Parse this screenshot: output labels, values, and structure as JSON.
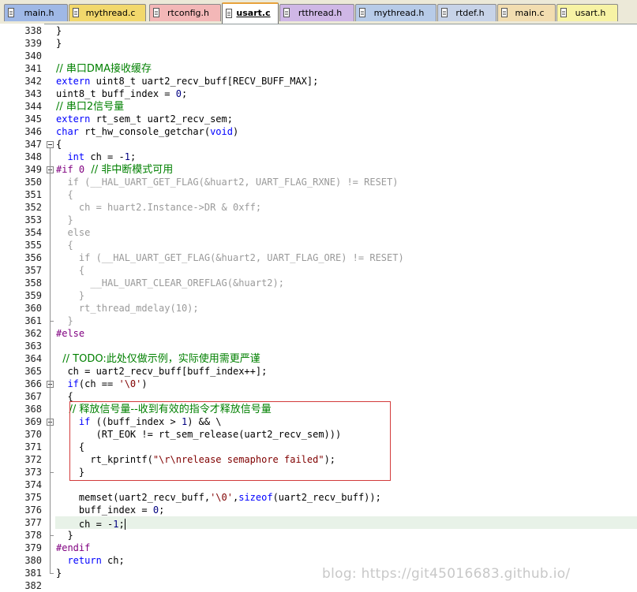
{
  "tabs": [
    {
      "label": "main.h",
      "color": "#9fb8e6",
      "active": false
    },
    {
      "label": "mythread.c",
      "color": "#f2d86c",
      "active": false
    },
    {
      "label": "rtconfig.h",
      "color": "#f3b7b7",
      "active": false
    },
    {
      "label": "usart.c",
      "color": "#ffffff",
      "active": true
    },
    {
      "label": "rtthread.h",
      "color": "#cfb7e6",
      "active": false
    },
    {
      "label": "mythread.h",
      "color": "#b7cbe8",
      "active": false
    },
    {
      "label": "rtdef.h",
      "color": "#c7d3e8",
      "active": false
    },
    {
      "label": "main.c",
      "color": "#f2ddb0",
      "active": false
    },
    {
      "label": "usart.h",
      "color": "#f7f3a4",
      "active": false
    }
  ],
  "lines": [
    {
      "n": "338",
      "segs": [
        {
          "t": "}",
          "c": "pl"
        }
      ]
    },
    {
      "n": "339",
      "segs": [
        {
          "t": "}",
          "c": "pl"
        }
      ]
    },
    {
      "n": "340",
      "segs": []
    },
    {
      "n": "341",
      "segs": [
        {
          "t": "// 串口DMA接收缓存",
          "c": "cm"
        }
      ]
    },
    {
      "n": "342",
      "segs": [
        {
          "t": "extern",
          "c": "kw"
        },
        {
          "t": " uint8_t uart2_recv_buff[RECV_BUFF_MAX];",
          "c": "pl"
        }
      ]
    },
    {
      "n": "343",
      "segs": [
        {
          "t": "uint8_t buff_index = ",
          "c": "pl"
        },
        {
          "t": "0",
          "c": "nm"
        },
        {
          "t": ";",
          "c": "pl"
        }
      ]
    },
    {
      "n": "344",
      "segs": [
        {
          "t": "// 串口2信号量",
          "c": "cm"
        }
      ]
    },
    {
      "n": "345",
      "segs": [
        {
          "t": "extern",
          "c": "kw"
        },
        {
          "t": " rt_sem_t uart2_recv_sem;",
          "c": "pl"
        }
      ]
    },
    {
      "n": "346",
      "segs": [
        {
          "t": "char",
          "c": "kw"
        },
        {
          "t": " rt_hw_console_getchar(",
          "c": "pl"
        },
        {
          "t": "void",
          "c": "kw"
        },
        {
          "t": ")",
          "c": "pl"
        }
      ]
    },
    {
      "n": "347",
      "segs": [
        {
          "t": "{",
          "c": "pl"
        }
      ]
    },
    {
      "n": "348",
      "segs": [
        {
          "t": "  ",
          "c": "pl"
        },
        {
          "t": "int",
          "c": "kw"
        },
        {
          "t": " ch = -",
          "c": "pl"
        },
        {
          "t": "1",
          "c": "nm"
        },
        {
          "t": ";",
          "c": "pl"
        }
      ]
    },
    {
      "n": "349",
      "segs": [
        {
          "t": "#if 0",
          "c": "pp"
        },
        {
          "t": "  // 非中断模式可用",
          "c": "cm"
        }
      ]
    },
    {
      "n": "350",
      "segs": [
        {
          "t": "  if (__HAL_UART_GET_FLAG(&huart2, UART_FLAG_RXNE) != RESET)",
          "c": "gr"
        }
      ]
    },
    {
      "n": "351",
      "segs": [
        {
          "t": "  {",
          "c": "gr"
        }
      ]
    },
    {
      "n": "352",
      "segs": [
        {
          "t": "    ch = huart2.Instance->DR & 0xff;",
          "c": "gr"
        }
      ]
    },
    {
      "n": "353",
      "segs": [
        {
          "t": "  }",
          "c": "gr"
        }
      ]
    },
    {
      "n": "354",
      "segs": [
        {
          "t": "  else",
          "c": "gr"
        }
      ]
    },
    {
      "n": "355",
      "segs": [
        {
          "t": "  {",
          "c": "gr"
        }
      ]
    },
    {
      "n": "356",
      "segs": [
        {
          "t": "    if (__HAL_UART_GET_FLAG(&huart2, UART_FLAG_ORE) != RESET)",
          "c": "gr"
        }
      ]
    },
    {
      "n": "357",
      "segs": [
        {
          "t": "    {",
          "c": "gr"
        }
      ]
    },
    {
      "n": "358",
      "segs": [
        {
          "t": "      __HAL_UART_CLEAR_OREFLAG(&huart2);",
          "c": "gr"
        }
      ]
    },
    {
      "n": "359",
      "segs": [
        {
          "t": "    }",
          "c": "gr"
        }
      ]
    },
    {
      "n": "360",
      "segs": [
        {
          "t": "    rt_thread_mdelay(10);",
          "c": "gr"
        }
      ]
    },
    {
      "n": "361",
      "segs": [
        {
          "t": "  }",
          "c": "gr"
        }
      ]
    },
    {
      "n": "362",
      "segs": [
        {
          "t": "#else",
          "c": "pp"
        }
      ]
    },
    {
      "n": "363",
      "segs": []
    },
    {
      "n": "364",
      "segs": [
        {
          "t": "  // TODO:此处仅做示例，实际使用需更严谨",
          "c": "cm"
        }
      ]
    },
    {
      "n": "365",
      "segs": [
        {
          "t": "  ch = uart2_recv_buff[buff_index++];",
          "c": "pl"
        }
      ]
    },
    {
      "n": "366",
      "segs": [
        {
          "t": "  ",
          "c": "pl"
        },
        {
          "t": "if",
          "c": "kw"
        },
        {
          "t": "(ch == ",
          "c": "pl"
        },
        {
          "t": "'\\0'",
          "c": "st"
        },
        {
          "t": ")",
          "c": "pl"
        }
      ]
    },
    {
      "n": "367",
      "segs": [
        {
          "t": "  {",
          "c": "pl"
        }
      ]
    },
    {
      "n": "368",
      "segs": [
        {
          "t": "    // 释放信号量--收到有效的指令才释放信号量",
          "c": "cm"
        }
      ]
    },
    {
      "n": "369",
      "segs": [
        {
          "t": "    ",
          "c": "pl"
        },
        {
          "t": "if",
          "c": "kw"
        },
        {
          "t": " ((buff_index > ",
          "c": "pl"
        },
        {
          "t": "1",
          "c": "nm"
        },
        {
          "t": ") && \\",
          "c": "pl"
        }
      ]
    },
    {
      "n": "370",
      "segs": [
        {
          "t": "       (RT_EOK != rt_sem_release(uart2_recv_sem)))",
          "c": "pl"
        }
      ]
    },
    {
      "n": "371",
      "segs": [
        {
          "t": "    {",
          "c": "pl"
        }
      ]
    },
    {
      "n": "372",
      "segs": [
        {
          "t": "      rt_kprintf(",
          "c": "pl"
        },
        {
          "t": "\"\\r\\nrelease semaphore failed\"",
          "c": "st"
        },
        {
          "t": ");",
          "c": "pl"
        }
      ]
    },
    {
      "n": "373",
      "segs": [
        {
          "t": "    }",
          "c": "pl"
        }
      ]
    },
    {
      "n": "374",
      "segs": []
    },
    {
      "n": "375",
      "segs": [
        {
          "t": "    memset(uart2_recv_buff,",
          "c": "pl"
        },
        {
          "t": "'\\0'",
          "c": "st"
        },
        {
          "t": ",",
          "c": "pl"
        },
        {
          "t": "sizeof",
          "c": "kw"
        },
        {
          "t": "(uart2_recv_buff));",
          "c": "pl"
        }
      ]
    },
    {
      "n": "376",
      "segs": [
        {
          "t": "    buff_index = ",
          "c": "pl"
        },
        {
          "t": "0",
          "c": "nm"
        },
        {
          "t": ";",
          "c": "pl"
        }
      ]
    },
    {
      "n": "377",
      "segs": [
        {
          "t": "    ch = -",
          "c": "pl"
        },
        {
          "t": "1",
          "c": "nm"
        },
        {
          "t": ";",
          "c": "pl"
        }
      ]
    },
    {
      "n": "378",
      "segs": [
        {
          "t": "  }",
          "c": "pl"
        }
      ]
    },
    {
      "n": "379",
      "segs": [
        {
          "t": "#endif",
          "c": "pp"
        }
      ]
    },
    {
      "n": "380",
      "segs": [
        {
          "t": "  ",
          "c": "pl"
        },
        {
          "t": "return",
          "c": "kw"
        },
        {
          "t": " ch;",
          "c": "pl"
        }
      ]
    },
    {
      "n": "381",
      "segs": [
        {
          "t": "}",
          "c": "pl"
        }
      ]
    },
    {
      "n": "382",
      "segs": []
    }
  ],
  "watermark": "blog: https://git45016683.github.io/",
  "colors": {
    "keyword": "#0000ff",
    "comment": "#008000",
    "string": "#800000",
    "number": "#000080",
    "preprocessor": "#800080",
    "inactive": "#9a9a9a",
    "current_line": "#e8f2e8",
    "highlight_box": "#d23a3a"
  }
}
